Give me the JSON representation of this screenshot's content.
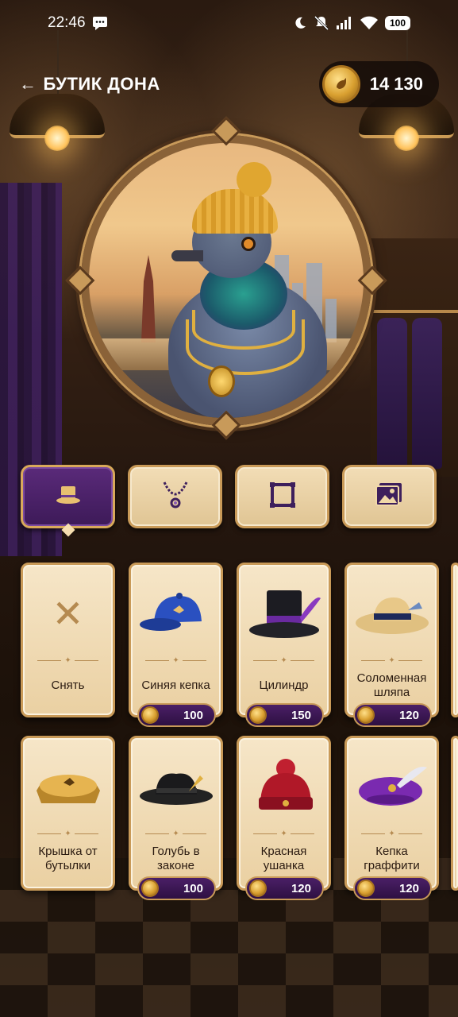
{
  "status_bar": {
    "time": "22:46",
    "battery": "100"
  },
  "header": {
    "back_arrow": "←",
    "title": "БУТИК ДОНА",
    "coins": "14 130"
  },
  "tabs": [
    {
      "icon": "top-hat-icon",
      "active": true
    },
    {
      "icon": "necklace-icon",
      "active": false
    },
    {
      "icon": "frame-icon",
      "active": false
    },
    {
      "icon": "picture-icon",
      "active": false
    }
  ],
  "items": [
    {
      "name": "Снять",
      "price": null
    },
    {
      "name": "Синяя кепка",
      "price": "100"
    },
    {
      "name": "Цилиндр",
      "price": "150"
    },
    {
      "name": "Соломенная шляпа",
      "price": "120"
    },
    {
      "name": "Крышка от бутылки",
      "price": null
    },
    {
      "name": "Голубь в законе",
      "price": "100"
    },
    {
      "name": "Красная ушанка",
      "price": "120"
    },
    {
      "name": "Кепка граффити",
      "price": "120"
    }
  ],
  "colors": {
    "accent_purple": "#4a1f66",
    "gold": "#c99a58",
    "card_bg": "#f6e6c8"
  }
}
